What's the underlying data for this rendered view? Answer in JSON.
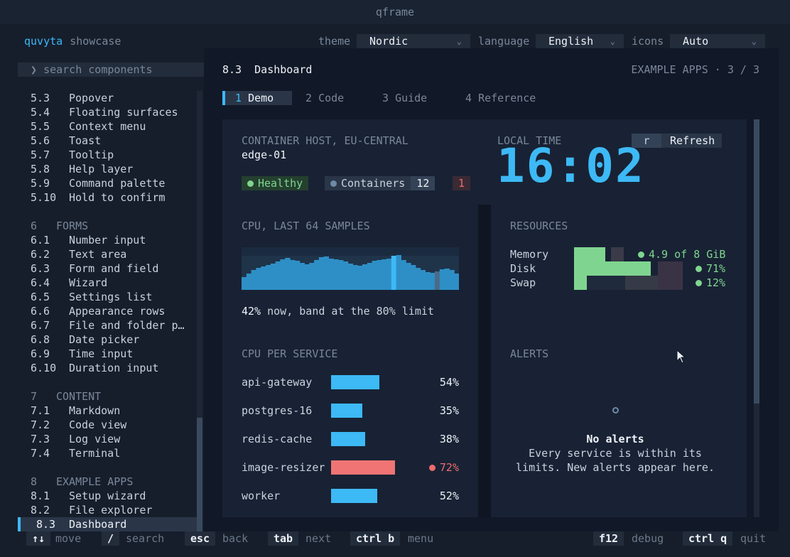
{
  "window": {
    "title": "qframe"
  },
  "brand": {
    "name": "quvyta",
    "subtitle": "showcase"
  },
  "header": {
    "theme_label": "theme",
    "theme_value": "Nordic",
    "language_label": "language",
    "language_value": "English",
    "icons_label": "icons",
    "icons_value": "Auto"
  },
  "sidebar": {
    "search_prompt": "❯",
    "search_placeholder": "search components",
    "rows": [
      {
        "kind": "item",
        "num": "5.3",
        "label": "Popover"
      },
      {
        "kind": "item",
        "num": "5.4",
        "label": "Floating surfaces"
      },
      {
        "kind": "item",
        "num": "5.5",
        "label": "Context menu"
      },
      {
        "kind": "item",
        "num": "5.6",
        "label": "Toast"
      },
      {
        "kind": "item",
        "num": "5.7",
        "label": "Tooltip"
      },
      {
        "kind": "item",
        "num": "5.8",
        "label": "Help layer"
      },
      {
        "kind": "item",
        "num": "5.9",
        "label": "Command palette"
      },
      {
        "kind": "item",
        "num": "5.10",
        "label": "Hold to confirm"
      },
      {
        "kind": "gap"
      },
      {
        "kind": "group",
        "num": "6",
        "label": "FORMS"
      },
      {
        "kind": "item",
        "num": "6.1",
        "label": "Number input"
      },
      {
        "kind": "item",
        "num": "6.2",
        "label": "Text area"
      },
      {
        "kind": "item",
        "num": "6.3",
        "label": "Form and field"
      },
      {
        "kind": "item",
        "num": "6.4",
        "label": "Wizard"
      },
      {
        "kind": "item",
        "num": "6.5",
        "label": "Settings list"
      },
      {
        "kind": "item",
        "num": "6.6",
        "label": "Appearance rows"
      },
      {
        "kind": "item",
        "num": "6.7",
        "label": "File and folder p…"
      },
      {
        "kind": "item",
        "num": "6.8",
        "label": "Date picker"
      },
      {
        "kind": "item",
        "num": "6.9",
        "label": "Time input"
      },
      {
        "kind": "item",
        "num": "6.10",
        "label": "Duration input"
      },
      {
        "kind": "gap"
      },
      {
        "kind": "group",
        "num": "7",
        "label": "CONTENT"
      },
      {
        "kind": "item",
        "num": "7.1",
        "label": "Markdown"
      },
      {
        "kind": "item",
        "num": "7.2",
        "label": "Code view"
      },
      {
        "kind": "item",
        "num": "7.3",
        "label": "Log view"
      },
      {
        "kind": "item",
        "num": "7.4",
        "label": "Terminal"
      },
      {
        "kind": "gap"
      },
      {
        "kind": "group",
        "num": "8",
        "label": "EXAMPLE APPS"
      },
      {
        "kind": "item",
        "num": "8.1",
        "label": "Setup wizard"
      },
      {
        "kind": "item",
        "num": "8.2",
        "label": "File explorer"
      },
      {
        "kind": "active",
        "num": "8.3",
        "label": "Dashboard"
      }
    ]
  },
  "main": {
    "title": "8.3  Dashboard",
    "meta": "EXAMPLE APPS · 3 / 3",
    "tabs": [
      {
        "num": "1",
        "label": "Demo"
      },
      {
        "num": "2",
        "label": "Code"
      },
      {
        "num": "3",
        "label": "Guide"
      },
      {
        "num": "4",
        "label": "Reference"
      }
    ]
  },
  "dashboard": {
    "host_caption": "CONTAINER HOST, EU-CENTRAL",
    "host_name": "edge-01",
    "status_healthy": "Healthy",
    "containers_label": "Containers",
    "containers_count": "12",
    "containers_alert": "1",
    "time_caption": "LOCAL TIME",
    "time_value": "16:02",
    "refresh_key": "r",
    "refresh_label": "Refresh",
    "cpu_caption": "CPU, LAST 64 SAMPLES",
    "cpu_now": "42%",
    "cpu_note": " now, band at the 80% limit",
    "cpu_samples": [
      0.3,
      0.38,
      0.46,
      0.52,
      0.55,
      0.58,
      0.62,
      0.66,
      0.72,
      0.75,
      0.7,
      0.68,
      0.64,
      0.6,
      0.64,
      0.7,
      0.76,
      0.78,
      0.74,
      0.72,
      0.7,
      0.66,
      0.62,
      0.58,
      0.56,
      0.6,
      0.64,
      0.68,
      0.7,
      0.72,
      0.74,
      0.8,
      0.82,
      0.7,
      0.64,
      0.58,
      0.52,
      0.46,
      0.42,
      0.4,
      0.44,
      0.48,
      0.5,
      0.46,
      0.38
    ],
    "cpu_highlight_index": 31,
    "cpu_limit": 0.8,
    "resources_caption": "RESOURCES",
    "resources": [
      {
        "name": "Memory",
        "value": "4.9 of 8 GiB",
        "fraction": 0.61
      },
      {
        "name": "Disk",
        "value": "71%",
        "fraction": 0.71
      },
      {
        "name": "Swap",
        "value": "12%",
        "fraction": 0.12
      }
    ],
    "services_caption": "CPU PER SERVICE",
    "services": [
      {
        "name": "api-gateway",
        "pct_text": "54%",
        "pct": 54,
        "alert": false
      },
      {
        "name": "postgres-16",
        "pct_text": "35%",
        "pct": 35,
        "alert": false
      },
      {
        "name": "redis-cache",
        "pct_text": "38%",
        "pct": 38,
        "alert": false
      },
      {
        "name": "image-resizer",
        "pct_text": "72%",
        "pct": 72,
        "alert": true
      },
      {
        "name": "worker",
        "pct_text": "52%",
        "pct": 52,
        "alert": false
      }
    ],
    "alerts_caption": "ALERTS",
    "alerts_empty_title": "No alerts",
    "alerts_empty_line1": "Every service is within its",
    "alerts_empty_line2": "limits. New alerts appear here."
  },
  "footer": [
    {
      "key": "↑↓",
      "label": "move"
    },
    {
      "key": "/",
      "label": "search"
    },
    {
      "key": "esc",
      "label": "back"
    },
    {
      "key": "tab",
      "label": "next"
    },
    {
      "key": "ctrl b",
      "label": "menu"
    },
    {
      "key": "f12",
      "label": "debug"
    },
    {
      "key": "ctrl q",
      "label": "quit"
    }
  ],
  "colors": {
    "accent": "#3db9f5",
    "healthy": "#7fd58f",
    "alert": "#ef6b6b",
    "bar": "#3db9f5",
    "bar_alert": "#f07474"
  }
}
